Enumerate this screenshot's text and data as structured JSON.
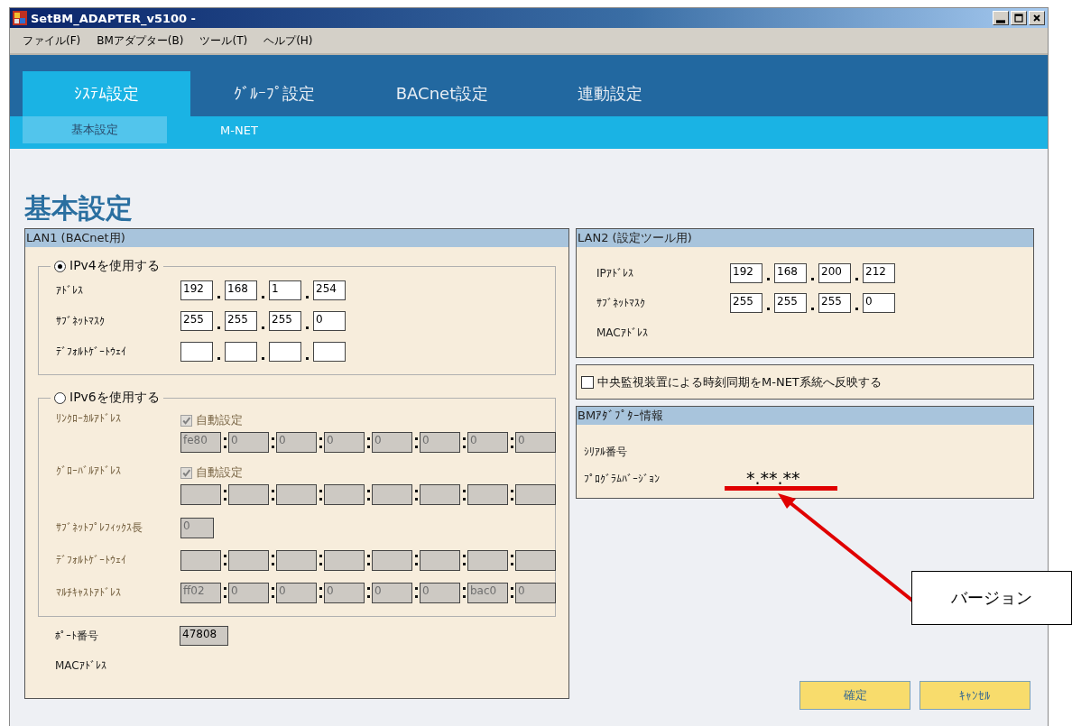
{
  "window": {
    "title": "SetBM_ADAPTER_v5100 -"
  },
  "menu": [
    {
      "label": "ファイル(F)"
    },
    {
      "label": "BMアダプター(B)"
    },
    {
      "label": "ツール(T)"
    },
    {
      "label": "ヘルプ(H)"
    }
  ],
  "tabs": [
    {
      "label": "ｼｽﾃﾑ設定",
      "selected": true
    },
    {
      "label": "ｸﾞﾙｰﾌﾟ設定",
      "selected": false
    },
    {
      "label": "BACnet設定",
      "selected": false
    },
    {
      "label": "連動設定",
      "selected": false
    }
  ],
  "subtabs": [
    {
      "label": "基本設定",
      "selected": true
    },
    {
      "label": "M-NET",
      "selected": false
    }
  ],
  "heading": "基本設定",
  "lan1": {
    "title": "LAN1 (BACnet用)",
    "ipv4": {
      "label": "IPv4を使用する",
      "selected": true,
      "rows": [
        {
          "label": "ｱﾄﾞﾚｽ",
          "octets": [
            "192",
            "168",
            "1",
            "254"
          ]
        },
        {
          "label": "ｻﾌﾞﾈｯﾄﾏｽｸ",
          "octets": [
            "255",
            "255",
            "255",
            "0"
          ]
        },
        {
          "label": "ﾃﾞﾌｫﾙﾄｹﾞｰﾄｳｪｲ",
          "empty": true
        }
      ]
    },
    "ipv6": {
      "label": "IPv6を使用する",
      "selected": false,
      "disabled": true,
      "rows": [
        {
          "kind": "groups",
          "label": "ﾘﾝｸﾛｰｶﾙｱﾄﾞﾚｽ",
          "auto": {
            "label": "自動設定",
            "checked": true
          },
          "groups": [
            "fe80",
            "0",
            "0",
            "0",
            "0",
            "0",
            "0",
            "0"
          ]
        },
        {
          "kind": "groups",
          "label": "ｸﾞﾛｰﾊﾞﾙｱﾄﾞﾚｽ",
          "auto": {
            "label": "自動設定",
            "checked": true
          },
          "empty": true
        },
        {
          "kind": "single",
          "label": "ｻﾌﾞﾈｯﾄﾌﾟﾚﾌｨｯｸｽ長",
          "value": "0"
        },
        {
          "kind": "groups",
          "label": "ﾃﾞﾌｫﾙﾄｹﾞｰﾄｳｪｲ",
          "empty": true
        },
        {
          "kind": "groups",
          "label": "ﾏﾙﾁｷｬｽﾄｱﾄﾞﾚｽ",
          "groups": [
            "ff02",
            "0",
            "0",
            "0",
            "0",
            "0",
            "bac0",
            "0"
          ]
        }
      ]
    },
    "port": {
      "label": "ﾎﾟｰﾄ番号",
      "value": "47808"
    },
    "mac_label": "MACｱﾄﾞﾚｽ"
  },
  "lan2": {
    "title": "LAN2 (設定ツール用)",
    "rows": [
      {
        "label": "IPｱﾄﾞﾚｽ",
        "octets": [
          "192",
          "168",
          "200",
          "212"
        ]
      },
      {
        "label": "ｻﾌﾞﾈｯﾄﾏｽｸ",
        "octets": [
          "255",
          "255",
          "255",
          "0"
        ]
      }
    ],
    "mac_label": "MACｱﾄﾞﾚｽ"
  },
  "time_sync": {
    "label": "中央監視装置による時刻同期をM-NET系統へ反映する",
    "checked": false
  },
  "bm_info": {
    "title": "BMｱﾀﾞﾌﾟﾀｰ情報",
    "rows": [
      {
        "label": "ｼﾘｱﾙ番号"
      },
      {
        "label": "ﾌﾟﾛｸﾞﾗﾑﾊﾞｰｼﾞｮﾝ",
        "value": "*.**.**"
      }
    ]
  },
  "buttons": [
    {
      "label": "確定"
    },
    {
      "label": "ｷｬﾝｾﾙ"
    }
  ],
  "annotation": {
    "label": "バージョン"
  }
}
